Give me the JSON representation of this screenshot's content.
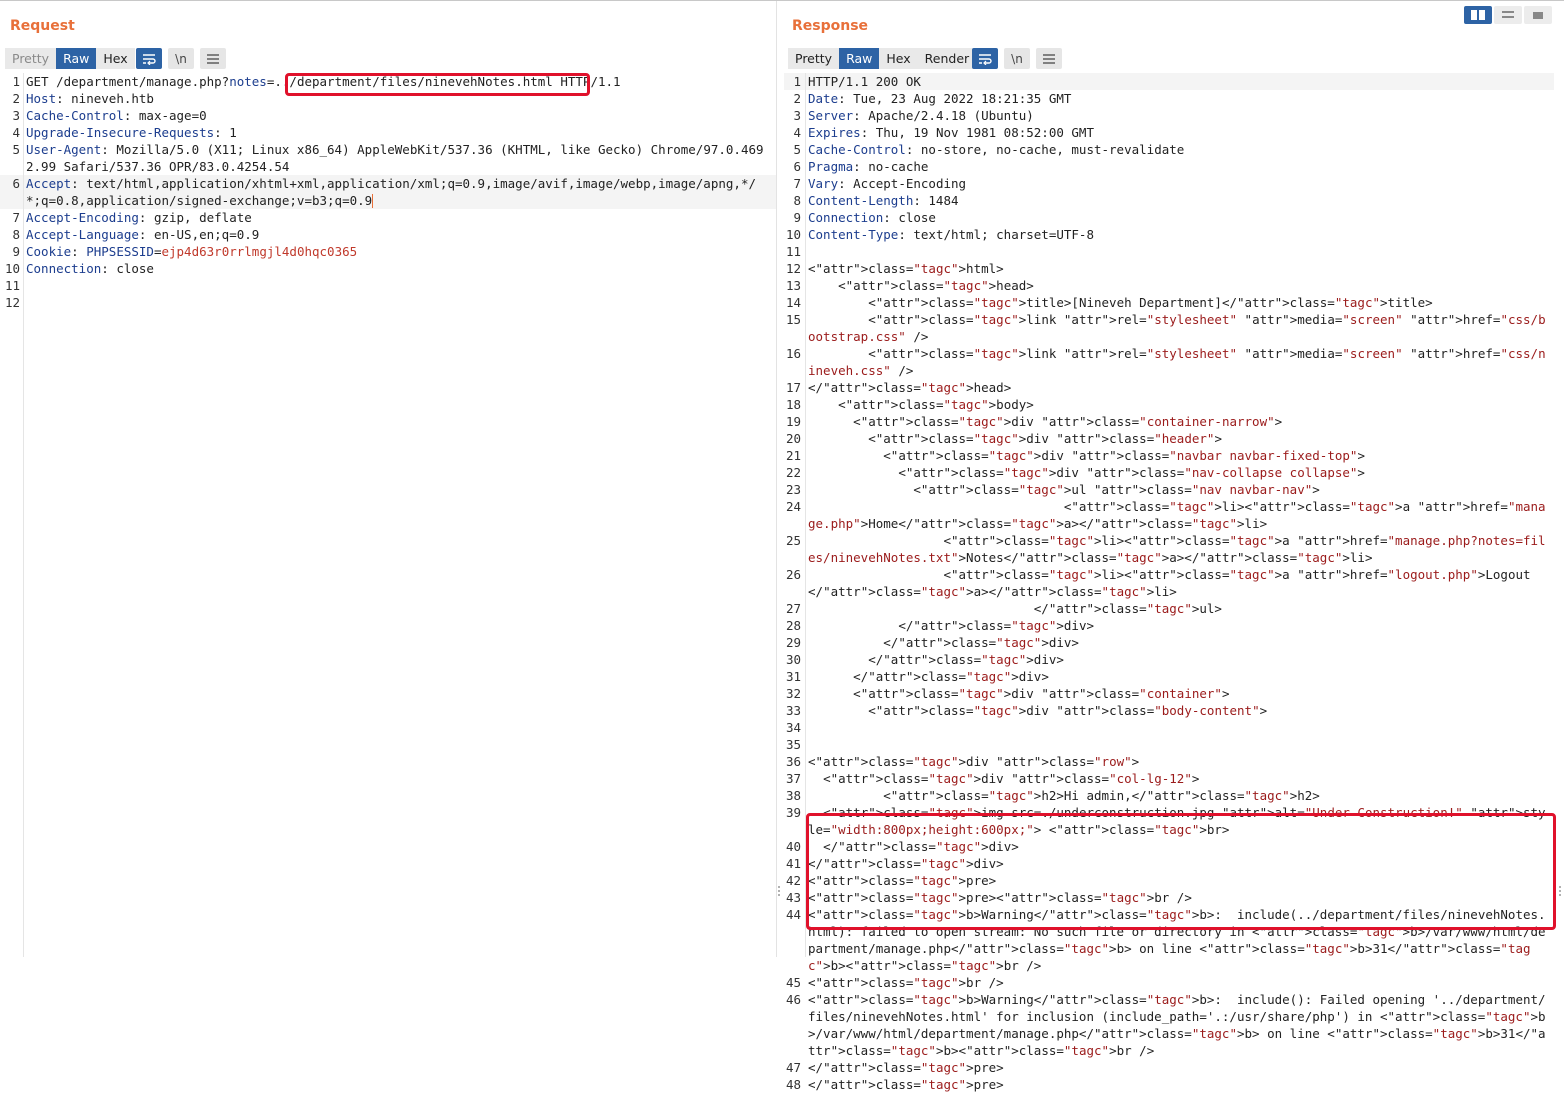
{
  "request": {
    "title": "Request",
    "tabs": [
      {
        "label": "Pretty",
        "state": "muted"
      },
      {
        "label": "Raw",
        "state": "active"
      },
      {
        "label": "Hex",
        "state": "normal"
      }
    ],
    "toolbar": {
      "newline_label": "\\n"
    },
    "lines": [
      {
        "n": "1",
        "text": "GET /department/manage.php?notes=../department/files/ninevehNotes.html HTTP/1.1"
      },
      {
        "n": "2",
        "text": "Host: nineveh.htb"
      },
      {
        "n": "3",
        "text": "Cache-Control: max-age=0"
      },
      {
        "n": "4",
        "text": "Upgrade-Insecure-Requests: 1"
      },
      {
        "n": "5",
        "text": "User-Agent: Mozilla/5.0 (X11; Linux x86_64) AppleWebKit/537.36 (KHTML, like Gecko) Chrome/97.0.4692.99 Safari/537.36 OPR/83.0.4254.54"
      },
      {
        "n": "6",
        "text": "Accept: text/html,application/xhtml+xml,application/xml;q=0.9,image/avif,image/webp,image/apng,*/*;q=0.8,application/signed-exchange;v=b3;q=0.9"
      },
      {
        "n": "7",
        "text": "Accept-Encoding: gzip, deflate"
      },
      {
        "n": "8",
        "text": "Accept-Language: en-US,en;q=0.9"
      },
      {
        "n": "9",
        "text": "Cookie: PHPSESSID=ejp4d63r0rrlmgjl4d0hqc0365"
      },
      {
        "n": "10",
        "text": "Connection: close"
      },
      {
        "n": "11",
        "text": ""
      },
      {
        "n": "12",
        "text": ""
      }
    ]
  },
  "response": {
    "title": "Response",
    "tabs": [
      {
        "label": "Pretty",
        "state": "normal"
      },
      {
        "label": "Raw",
        "state": "active"
      },
      {
        "label": "Hex",
        "state": "normal"
      },
      {
        "label": "Render",
        "state": "normal"
      }
    ],
    "toolbar": {
      "newline_label": "\\n"
    },
    "lines": [
      {
        "n": "1",
        "text": "HTTP/1.1 200 OK"
      },
      {
        "n": "2",
        "text": "Date: Tue, 23 Aug 2022 18:21:35 GMT"
      },
      {
        "n": "3",
        "text": "Server: Apache/2.4.18 (Ubuntu)"
      },
      {
        "n": "4",
        "text": "Expires: Thu, 19 Nov 1981 08:52:00 GMT"
      },
      {
        "n": "5",
        "text": "Cache-Control: no-store, no-cache, must-revalidate"
      },
      {
        "n": "6",
        "text": "Pragma: no-cache"
      },
      {
        "n": "7",
        "text": "Vary: Accept-Encoding"
      },
      {
        "n": "8",
        "text": "Content-Length: 1484"
      },
      {
        "n": "9",
        "text": "Connection: close"
      },
      {
        "n": "10",
        "text": "Content-Type: text/html; charset=UTF-8"
      },
      {
        "n": "11",
        "text": ""
      },
      {
        "n": "12",
        "text": "<html>"
      },
      {
        "n": "13",
        "text": "    <head>"
      },
      {
        "n": "14",
        "text": "        <title>[Nineveh Department]</title>"
      },
      {
        "n": "15",
        "text": "        <link rel=\"stylesheet\" media=\"screen\" href=\"css/bootstrap.css\" />"
      },
      {
        "n": "16",
        "text": "        <link rel=\"stylesheet\" media=\"screen\" href=\"css/nineveh.css\" />"
      },
      {
        "n": "17",
        "text": "</head>"
      },
      {
        "n": "18",
        "text": "    <body>"
      },
      {
        "n": "19",
        "text": "      <div class=\"container-narrow\">"
      },
      {
        "n": "20",
        "text": "        <div class=\"header\">"
      },
      {
        "n": "21",
        "text": "          <div class=\"navbar navbar-fixed-top\">"
      },
      {
        "n": "22",
        "text": "            <div class=\"nav-collapse collapse\">"
      },
      {
        "n": "23",
        "text": "              <ul class=\"nav navbar-nav\">"
      },
      {
        "n": "24",
        "text": "                                  <li><a href=\"manage.php\">Home</a></li>"
      },
      {
        "n": "25",
        "text": "                  <li><a href=\"manage.php?notes=files/ninevehNotes.txt\">Notes</a></li>"
      },
      {
        "n": "26",
        "text": "                  <li><a href=\"logout.php\">Logout</a></li>"
      },
      {
        "n": "27",
        "text": "                              </ul>"
      },
      {
        "n": "28",
        "text": "            </div>"
      },
      {
        "n": "29",
        "text": "          </div>"
      },
      {
        "n": "30",
        "text": "        </div>"
      },
      {
        "n": "31",
        "text": "      </div>"
      },
      {
        "n": "32",
        "text": "      <div class=\"container\">"
      },
      {
        "n": "33",
        "text": "        <div class=\"body-content\">"
      },
      {
        "n": "34",
        "text": ""
      },
      {
        "n": "35",
        "text": ""
      },
      {
        "n": "36",
        "text": "<div class=\"row\">"
      },
      {
        "n": "37",
        "text": "  <div class=\"col-lg-12\">"
      },
      {
        "n": "38",
        "text": "          <h2>Hi admin,</h2>"
      },
      {
        "n": "39",
        "text": "  <img src=./underconstruction.jpg alt=\"Under Construction!\" style=\"width:800px;height:600px;\"> <br>"
      },
      {
        "n": "40",
        "text": "  </div>"
      },
      {
        "n": "41",
        "text": "</div>"
      },
      {
        "n": "42",
        "text": "<pre>"
      },
      {
        "n": "43",
        "text": "<pre><br />"
      },
      {
        "n": "44",
        "text": "<b>Warning</b>:  include(../department/files/ninevehNotes.html): failed to open stream: No such file or directory in <b>/var/www/html/department/manage.php</b> on line <b>31</b><br />"
      },
      {
        "n": "45",
        "text": "<br />"
      },
      {
        "n": "46",
        "text": "<b>Warning</b>:  include(): Failed opening '../department/files/ninevehNotes.html' for inclusion (include_path='.:/usr/share/php') in <b>/var/www/html/department/manage.php</b> on line <b>31</b><br />"
      },
      {
        "n": "47",
        "text": "</pre>"
      },
      {
        "n": "48",
        "text": "</pre>"
      }
    ]
  },
  "colors": {
    "accent": "#e8703a",
    "active_tab": "#2d63a5",
    "highlight_box": "#e0112b",
    "markup_tag": "#9b1b1b",
    "header_key": "#1c3d8e"
  }
}
